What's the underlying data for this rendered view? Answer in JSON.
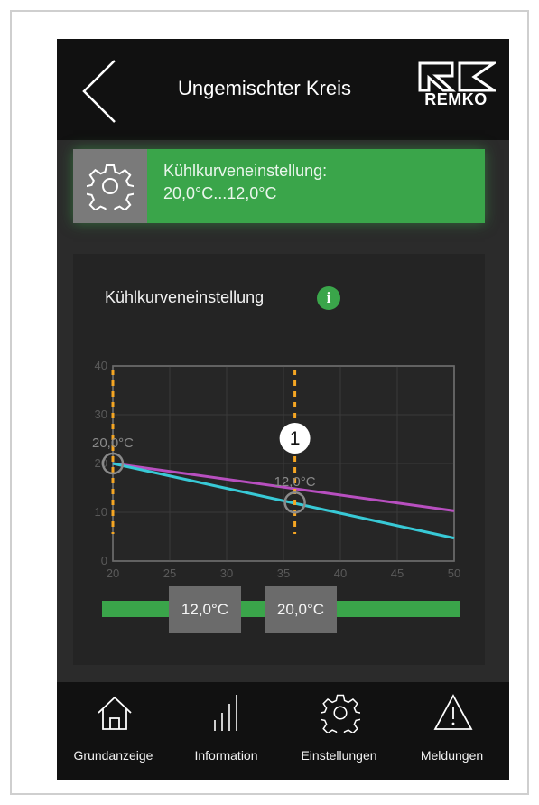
{
  "header": {
    "title": "Ungemischter Kreis",
    "logo_text": "REMKO"
  },
  "status": {
    "title": "Kühlkurveneinstellung:",
    "value": "20,0°C...12,0°C"
  },
  "panel": {
    "title": "Kühlkurveneinstellung",
    "info_label": "i"
  },
  "chart_data": {
    "type": "line",
    "x_ticks": [
      "20",
      "25",
      "30",
      "35",
      "40",
      "45",
      "50"
    ],
    "y_ticks": [
      "0",
      "10",
      "20",
      "30",
      "40"
    ],
    "xlim": [
      20,
      50
    ],
    "ylim": [
      0,
      40
    ],
    "grid": true,
    "series": [
      {
        "color": "#b84fc0",
        "points": [
          [
            20,
            20
          ],
          [
            50,
            10.3
          ]
        ]
      },
      {
        "color": "#38c9d6",
        "points": [
          [
            20,
            20
          ],
          [
            50,
            4.7
          ]
        ]
      }
    ],
    "markers": [
      {
        "x": 20,
        "y": 20,
        "label": "20,0°C"
      },
      {
        "x": 36,
        "y": 12,
        "label": "12,0°C"
      }
    ],
    "callout": "1"
  },
  "slider": {
    "low_label": "12,0°C",
    "high_label": "20,0°C"
  },
  "nav": {
    "items": [
      {
        "label": "Grundanzeige",
        "icon": "home-icon"
      },
      {
        "label": "Information",
        "icon": "bars-icon"
      },
      {
        "label": "Einstellungen",
        "icon": "gear-icon"
      },
      {
        "label": "Meldungen",
        "icon": "warning-icon"
      }
    ]
  },
  "colors": {
    "accent_green": "#3aa54a",
    "curve_purple": "#b84fc0",
    "curve_cyan": "#38c9d6",
    "marker_orange": "#f5a623"
  }
}
